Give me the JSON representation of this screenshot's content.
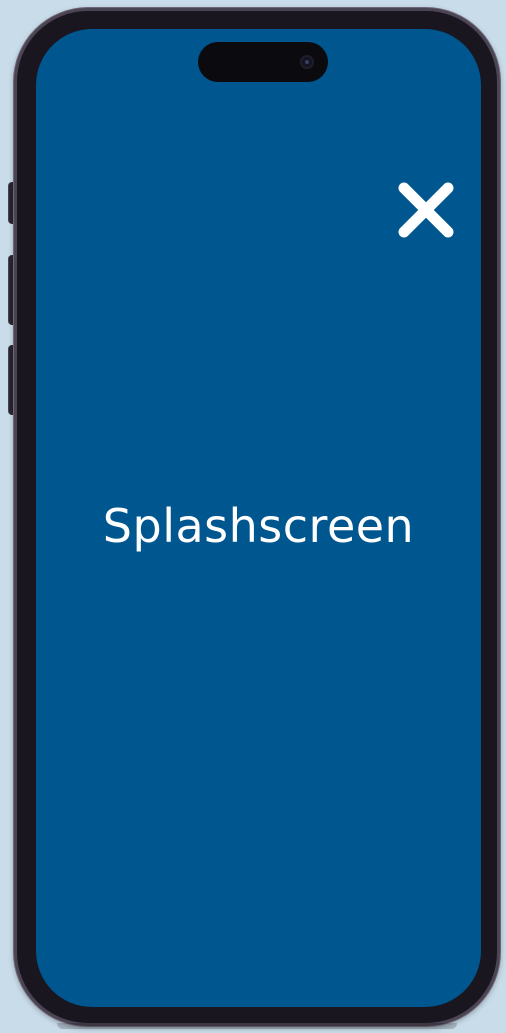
{
  "splash": {
    "title": "Splashscreen"
  },
  "icons": {
    "close": "close-icon",
    "camera": "camera-icon"
  },
  "colors": {
    "screen_background": "#00568f",
    "text": "#ffffff",
    "frame": "#191620",
    "page_background": "#c9dcea"
  }
}
